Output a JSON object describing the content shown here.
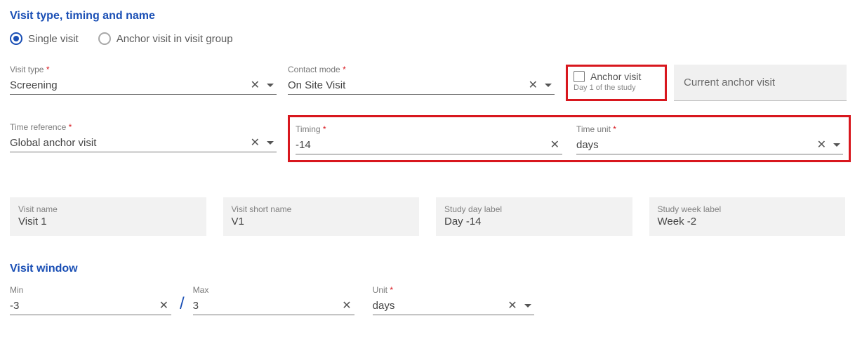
{
  "sections": {
    "visit_section_title": "Visit type, timing and name",
    "window_section_title": "Visit window"
  },
  "radio": {
    "single": "Single visit",
    "anchor": "Anchor visit in visit group"
  },
  "fields": {
    "visit_type_label": "Visit type",
    "visit_type_value": "Screening",
    "contact_mode_label": "Contact mode",
    "contact_mode_value": "On Site Visit",
    "anchor_visit_label": "Anchor visit",
    "anchor_visit_sub": "Day 1 of the study",
    "current_anchor_label": "Current anchor visit",
    "time_ref_label": "Time reference",
    "time_ref_value": "Global anchor visit",
    "timing_label": "Timing",
    "timing_value": "-14",
    "time_unit_label": "Time unit",
    "time_unit_value": "days"
  },
  "info": {
    "vn_label": "Visit name",
    "vn_value": "Visit 1",
    "vsn_label": "Visit short name",
    "vsn_value": "V1",
    "sdl_label": "Study day label",
    "sdl_value": "Day -14",
    "swl_label": "Study week label",
    "swl_value": "Week -2"
  },
  "window": {
    "min_label": "Min",
    "min_value": "-3",
    "max_label": "Max",
    "max_value": "3",
    "unit_label": "Unit",
    "unit_value": "days"
  },
  "glyphs": {
    "clear": "✕"
  }
}
